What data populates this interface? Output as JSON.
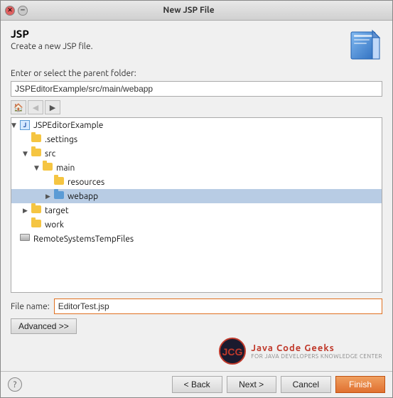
{
  "window": {
    "title": "New JSP File"
  },
  "header": {
    "title": "JSP",
    "subtitle": "Create a new JSP file."
  },
  "folder_label": "Enter or select the parent folder:",
  "folder_value": "JSPEditorExample/src/main/webapp",
  "tree": {
    "items": [
      {
        "id": "root",
        "label": "JSPEditorExample",
        "type": "project",
        "indent": 0,
        "expanded": true
      },
      {
        "id": "settings",
        "label": ".settings",
        "type": "folder",
        "indent": 1,
        "expanded": false
      },
      {
        "id": "src",
        "label": "src",
        "type": "folder",
        "indent": 1,
        "expanded": true
      },
      {
        "id": "main",
        "label": "main",
        "type": "folder",
        "indent": 2,
        "expanded": true
      },
      {
        "id": "resources",
        "label": "resources",
        "type": "folder",
        "indent": 3,
        "expanded": false
      },
      {
        "id": "webapp",
        "label": "webapp",
        "type": "folder",
        "indent": 3,
        "expanded": false,
        "selected": true
      },
      {
        "id": "target",
        "label": "target",
        "type": "folder",
        "indent": 1,
        "expanded": false
      },
      {
        "id": "work",
        "label": "work",
        "type": "folder",
        "indent": 1,
        "expanded": false
      },
      {
        "id": "remote",
        "label": "RemoteSystemsTempFiles",
        "type": "drive",
        "indent": 0,
        "expanded": false
      }
    ]
  },
  "file_name_label": "File name:",
  "file_name_value": "EditorTest.jsp",
  "advanced_btn": "Advanced >>",
  "branding": {
    "name": "Java Code Geeks",
    "tagline": "FOR JAVA DEVELOPERS KNOWLEDGE CENTER"
  },
  "footer": {
    "back": "< Back",
    "next": "Next >",
    "cancel": "Cancel",
    "finish": "Finish"
  }
}
